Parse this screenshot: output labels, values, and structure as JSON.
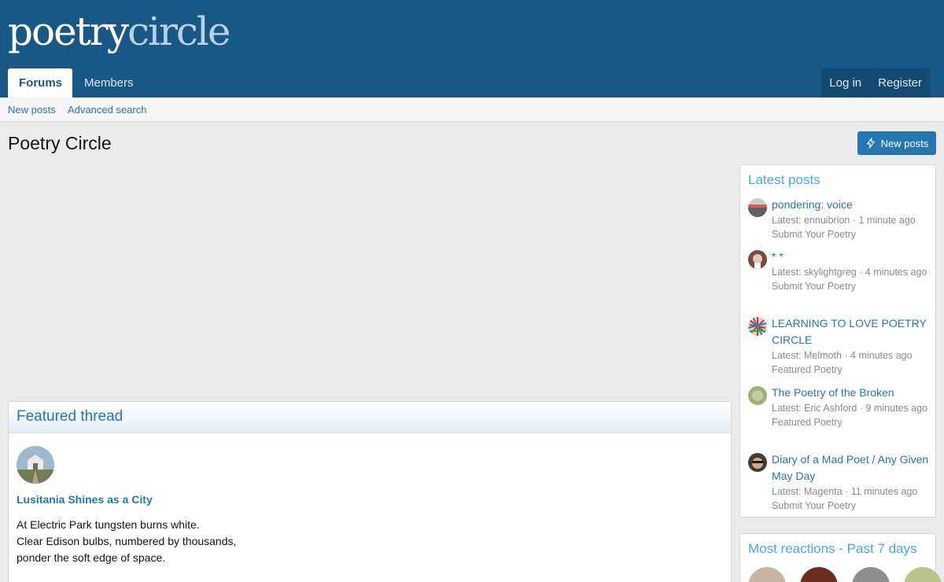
{
  "header": {
    "logo_part1": "poetry",
    "logo_part2": "circle",
    "tabs": [
      {
        "label": "Forums"
      },
      {
        "label": "Members"
      }
    ],
    "account": {
      "login": "Log in",
      "register": "Register"
    }
  },
  "subnav": {
    "items": [
      {
        "label": "New posts"
      },
      {
        "label": "Advanced search"
      }
    ]
  },
  "page": {
    "title": "Poetry Circle",
    "new_posts_button": "New posts"
  },
  "featured": {
    "heading": "Featured thread",
    "thread_title": "Lusitania Shines as a City",
    "lines": [
      "At Electric Park tungsten burns white.",
      "Clear Edison bulbs, numbered by thousands,",
      "ponder the soft edge of space."
    ]
  },
  "latest_posts": {
    "heading": "Latest posts",
    "items": [
      {
        "title": "pondering: voice",
        "meta": "Latest: ennuibrion · 1 minute ago",
        "forum": "Submit Your Poetry"
      },
      {
        "title": "* *",
        "meta": "Latest: skylightgreg · 4 minutes ago",
        "forum": "Submit Your Poetry"
      },
      {
        "title": "LEARNING TO LOVE POETRY CIRCLE",
        "meta": "Latest: Melmoth · 4 minutes ago",
        "forum": "Featured Poetry"
      },
      {
        "title": "The Poetry of the Broken",
        "meta": "Latest: Eric Ashford · 9 minutes ago",
        "forum": "Featured Poetry"
      },
      {
        "title": "Diary of a Mad Poet / Any Given May Day",
        "meta": "Latest: Magenta · 11 minutes ago",
        "forum": "Submit Your Poetry"
      }
    ]
  },
  "most_reactions": {
    "heading": "Most reactions - Past 7 days"
  }
}
